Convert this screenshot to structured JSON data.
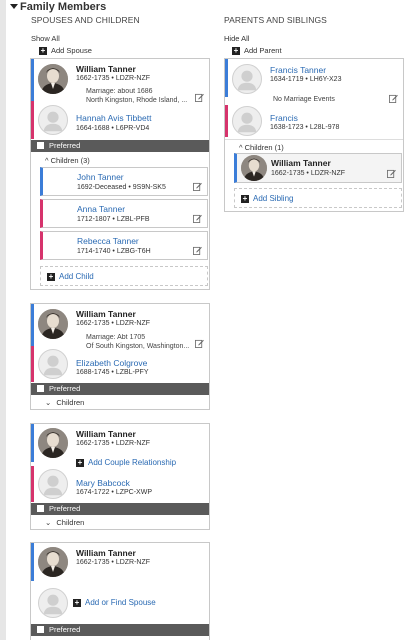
{
  "header": {
    "title": "Family Members"
  },
  "left": {
    "heading": "SPOUSES AND CHILDREN",
    "show_all": "Show All",
    "add_spouse": "Add Spouse",
    "families": [
      {
        "husband": {
          "name": "William Tanner",
          "meta": "1662-1735 • LDZR-NZF"
        },
        "marriage_line1": "Marriage: about 1686",
        "marriage_line2": "North Kingston, Rhode Island, ...",
        "wife": {
          "name": "Hannah Avis Tibbett",
          "meta": "1664-1688 • L6PR-VD4"
        },
        "preferred": "Preferred",
        "children_label": "Children (3)",
        "children": [
          {
            "name": "John Tanner",
            "meta": "1692-Deceased • 9S9N-SK5"
          },
          {
            "name": "Anna Tanner",
            "meta": "1712-1807 • LZBL-PFB"
          },
          {
            "name": "Rebecca Tanner",
            "meta": "1714-1740 • LZBG-T6H"
          }
        ],
        "add_child": "Add Child"
      },
      {
        "husband": {
          "name": "William Tanner",
          "meta": "1662-1735 • LDZR-NZF"
        },
        "marriage_line1": "Marriage: Abt 1705",
        "marriage_line2": "Of South Kingston, Washington...",
        "wife": {
          "name": "Elizabeth Colgrove",
          "meta": "1688-1745 • LZBL-PFY"
        },
        "preferred": "Preferred",
        "children_label": "Children"
      },
      {
        "husband": {
          "name": "William Tanner",
          "meta": "1662-1735 • LDZR-NZF"
        },
        "add_couple": "Add Couple Relationship",
        "wife": {
          "name": "Mary Babcock",
          "meta": "1674-1722 • LZPC-XWP"
        },
        "preferred": "Preferred",
        "children_label": "Children"
      },
      {
        "husband": {
          "name": "William Tanner",
          "meta": "1662-1735 • LDZR-NZF"
        },
        "add_spouse": "Add or Find Spouse",
        "preferred": "Preferred"
      }
    ]
  },
  "right": {
    "heading": "PARENTS AND SIBLINGS",
    "hide_all": "Hide All",
    "add_parent": "Add Parent",
    "father": {
      "name": "Francis Tanner",
      "meta": "1634-1719 • LH6Y-X23"
    },
    "no_marriage": "No Marriage Events",
    "mother": {
      "name": "Francis",
      "meta": "1638-1723 • L28L-978"
    },
    "children_label": "Children (1)",
    "child": {
      "name": "William Tanner",
      "meta": "1662-1735 • LDZR-NZF"
    },
    "add_sibling": "Add Sibling"
  },
  "colors": {
    "male": "#3b7dd8",
    "female": "#d6336c",
    "link": "#2a6ab3",
    "preferred_bar": "#5a5a5a"
  }
}
